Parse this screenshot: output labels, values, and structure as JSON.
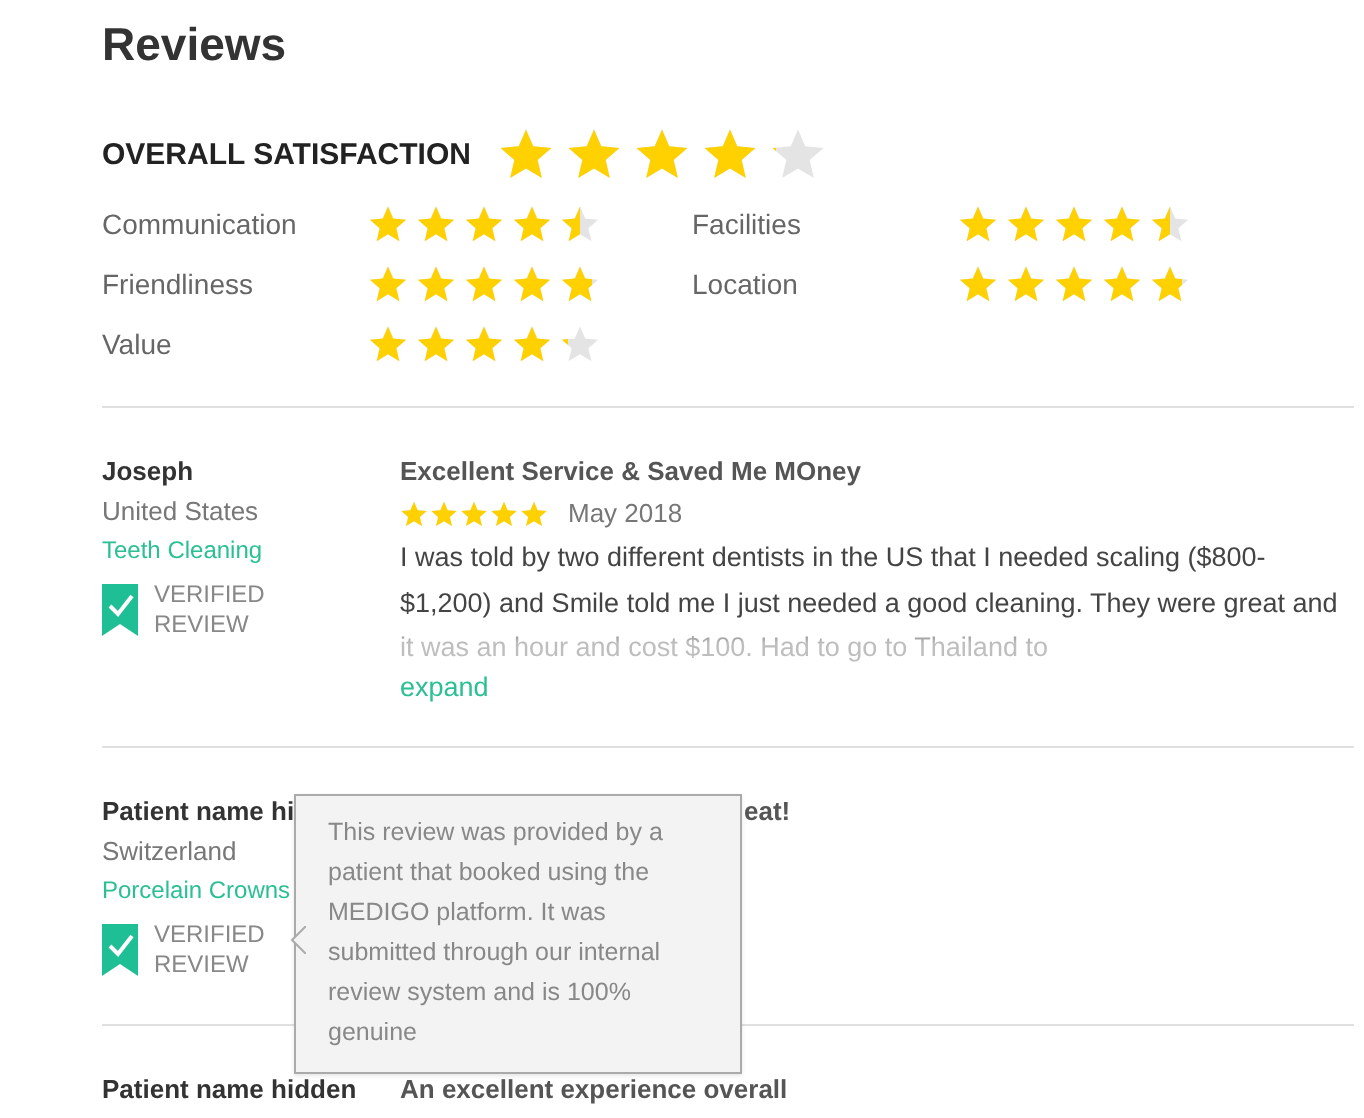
{
  "heading": "Reviews",
  "overall": {
    "label": "OVERALL SATISFACTION",
    "stars": 4.1
  },
  "ratings": [
    {
      "label": "Communication",
      "stars": 4.5
    },
    {
      "label": "Facilities",
      "stars": 4.5
    },
    {
      "label": "Friendliness",
      "stars": 4.8
    },
    {
      "label": "Location",
      "stars": 4.8
    },
    {
      "label": "Value",
      "stars": 4.2
    }
  ],
  "reviews": [
    {
      "name": "Joseph",
      "country": "United States",
      "treatment": "Teeth Cleaning",
      "verified": true,
      "verified_label": "VERIFIED REVIEW",
      "title": "Excellent Service & Saved Me MOney",
      "stars": 5,
      "date": "May 2018",
      "body": "I was told by two different dentists in the US that I needed scaling ($800- $1,200) and Smile told me I just needed a good cleaning. They were great and it was an hour and cost $100. Had to go to Thailand to",
      "expand": "expand"
    },
    {
      "name": "Patient name hi",
      "country": "Switzerland",
      "treatment": "Porcelain Crowns",
      "verified": true,
      "verified_label": "VERIFIED REVIEW",
      "title": "eat!",
      "tooltip": "This review was provided by a patient that booked using the MEDIGO platform. It was submitted through our internal review system and is 100% genuine"
    },
    {
      "name": "Patient name hidden",
      "title": "An excellent experience overall"
    }
  ]
}
